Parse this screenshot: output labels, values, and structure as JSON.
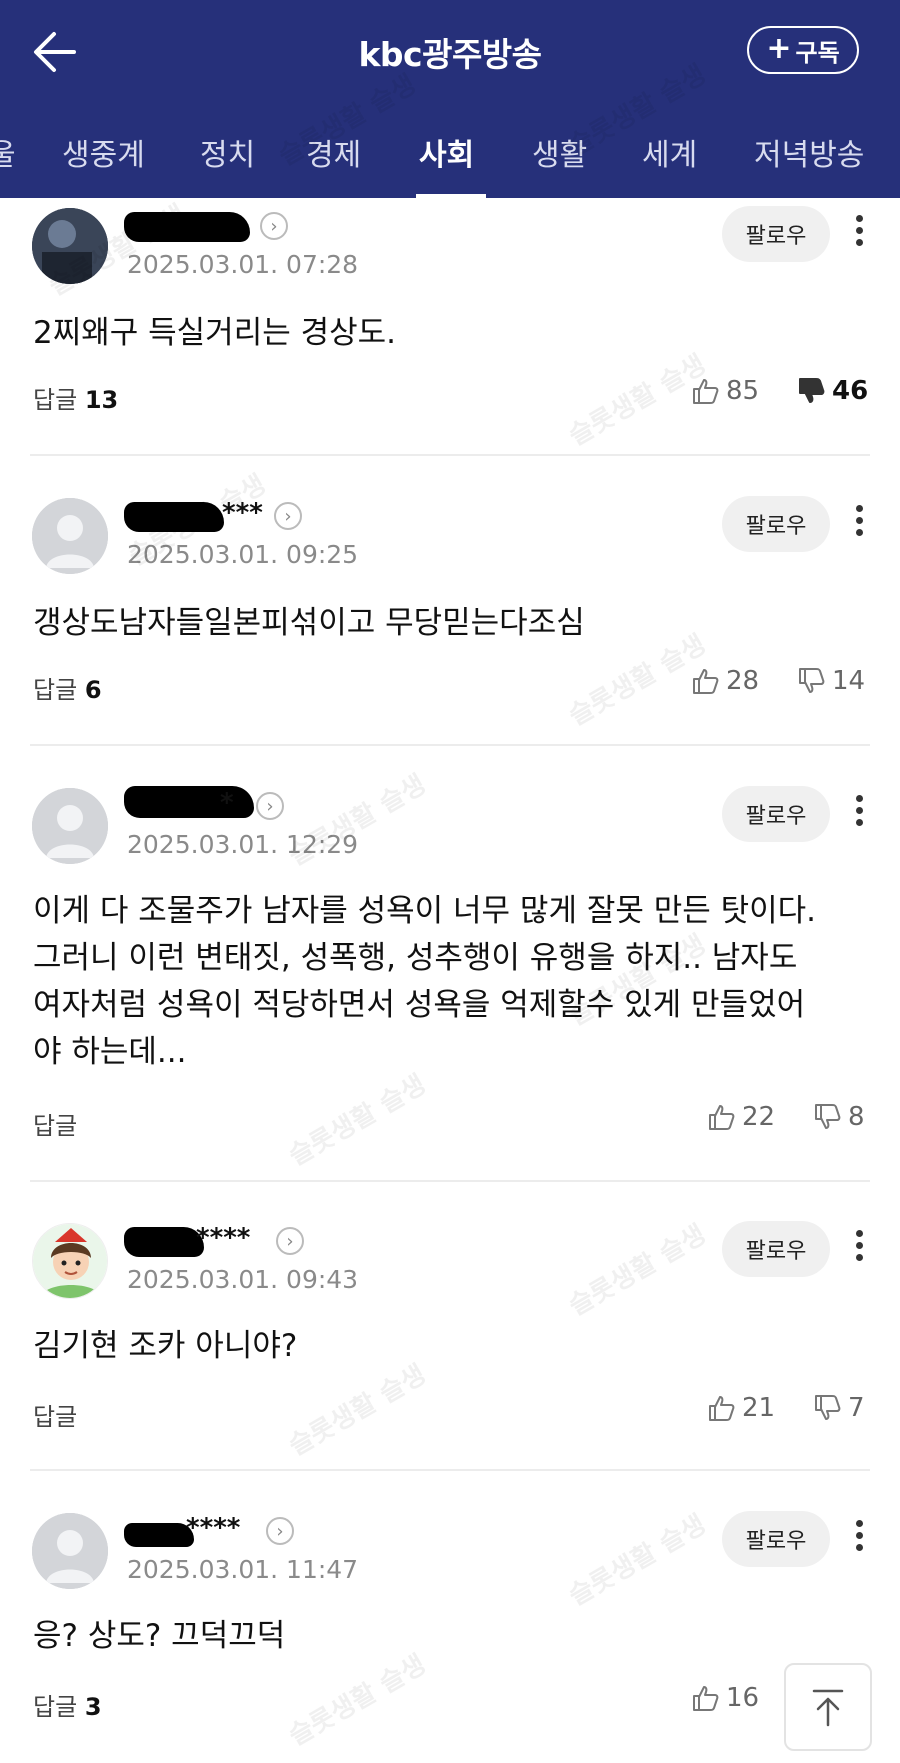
{
  "header": {
    "title": "kbc광주방송",
    "subscribe_label": "구독",
    "subscribe_plus": "+"
  },
  "tabs": [
    {
      "label": "울"
    },
    {
      "label": "생중계"
    },
    {
      "label": "정치"
    },
    {
      "label": "경제"
    },
    {
      "label": "사회"
    },
    {
      "label": "생활"
    },
    {
      "label": "세계"
    },
    {
      "label": "저녁방송"
    }
  ],
  "active_tab": "사회",
  "follow_label": "팔로우",
  "comments": [
    {
      "name_suffix": "",
      "time": "2025.03.01. 07:28",
      "text": "2찌왜구 득실거리는 경상도.",
      "reply_label": "답글",
      "reply_count": "13",
      "likes": "85",
      "dislikes": "46"
    },
    {
      "name_suffix": "***",
      "time": "2025.03.01. 09:25",
      "text": "갱상도남자들일본피섞이고 무당믿는다조심",
      "reply_label": "답글",
      "reply_count": "6",
      "likes": "28",
      "dislikes": "14"
    },
    {
      "name_suffix": "*",
      "time": "2025.03.01. 12:29",
      "text": "이게 다 조물주가 남자를 성욕이 너무 많게 잘못 만든 탓이다. 그러니 이런 변태짓, 성폭행, 성추행이 유행을 하지.. 남자도 여자처럼 성욕이 적당하면서 성욕을 억제할수 있게 만들었어야 하는데...",
      "reply_label": "답글",
      "reply_count": "",
      "likes": "22",
      "dislikes": "8"
    },
    {
      "name_suffix": "****",
      "time": "2025.03.01. 09:43",
      "text": "김기현 조카 아니야?",
      "reply_label": "답글",
      "reply_count": "",
      "likes": "21",
      "dislikes": "7"
    },
    {
      "name_suffix": "****",
      "time": "2025.03.01. 11:47",
      "text": "응? 상도? 끄덕끄덕",
      "reply_label": "답글",
      "reply_count": "3",
      "likes": "16",
      "dislikes": ""
    }
  ],
  "watermark_text": "슬롯생활 슬생",
  "colors": {
    "header_bg": "#26307a",
    "text": "#111111",
    "muted": "#8a8a8a"
  }
}
